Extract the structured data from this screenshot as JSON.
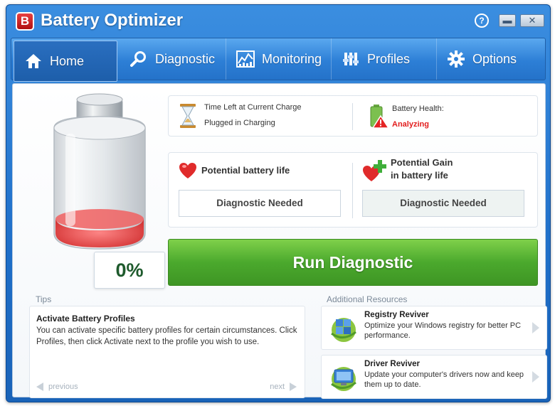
{
  "app": {
    "title": "Battery Optimizer",
    "logo_letter": "B"
  },
  "window_controls": {
    "help": "?",
    "minimize": "▬",
    "close": "✕"
  },
  "nav": {
    "items": [
      {
        "label": "Home",
        "icon": "home-icon",
        "active": true
      },
      {
        "label": "Diagnostic",
        "icon": "search-icon",
        "active": false
      },
      {
        "label": "Monitoring",
        "icon": "chart-icon",
        "active": false
      },
      {
        "label": "Profiles",
        "icon": "profiles-icon",
        "active": false
      },
      {
        "label": "Options",
        "icon": "gear-icon",
        "active": false
      }
    ]
  },
  "battery": {
    "percent_label": "0%",
    "level_fraction": 0.0,
    "fill_color": "#e23a3a"
  },
  "status": {
    "time_left_label": "Time Left at Current Charge",
    "plugged_label": "Plugged in Charging",
    "health_label": "Battery Health:",
    "health_value": "Analyzing"
  },
  "potential": {
    "life_label": "Potential battery life",
    "life_value": "Diagnostic Needed",
    "gain_label_line1": "Potential Gain",
    "gain_label_line2": "in battery life",
    "gain_value": "Diagnostic Needed"
  },
  "run_button": {
    "label": "Run Diagnostic"
  },
  "tips": {
    "title": "Tips",
    "heading": "Activate Battery Profiles",
    "text": "You can activate specific battery profiles for certain circumstances. Click Profiles, then click Activate next to the profile you wish to use.",
    "previous": "previous",
    "next": "next"
  },
  "resources": {
    "title": "Additional Resources",
    "items": [
      {
        "title": "Registry Reviver",
        "desc": "Optimize your Windows registry for better PC performance."
      },
      {
        "title": "Driver Reviver",
        "desc": "Update your computer's drivers now and keep them up to date."
      }
    ]
  },
  "colors": {
    "accent_blue": "#1f6fc9",
    "run_green": "#4ba92d",
    "alert_red": "#e21d1d"
  }
}
